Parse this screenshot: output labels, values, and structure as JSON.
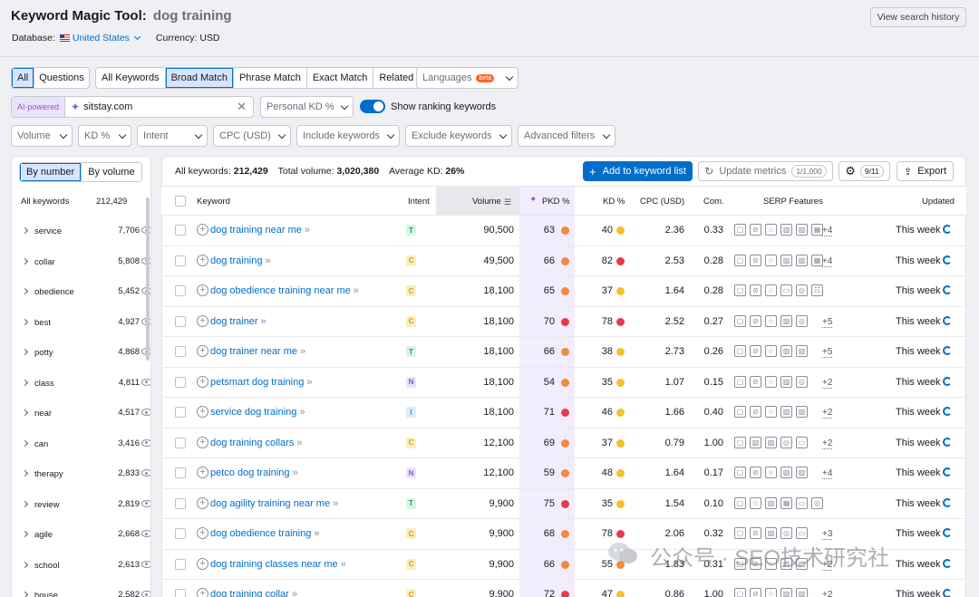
{
  "header": {
    "title": "Keyword Magic Tool:",
    "query": "dog training",
    "database_label": "Database:",
    "database_value": "United States",
    "currency_label": "Currency: USD",
    "history_button": "View search history"
  },
  "tabs_group1": [
    "All",
    "Questions"
  ],
  "tabs_group2": [
    "All Keywords",
    "Broad Match",
    "Phrase Match",
    "Exact Match",
    "Related"
  ],
  "languages": {
    "label": "Languages",
    "badge": "beta"
  },
  "ai": {
    "badge": "AI-powered",
    "domain": "sitstay.com"
  },
  "personal_kd": "Personal KD %",
  "ranking_toggle": "Show ranking keywords",
  "filters": [
    "Volume",
    "KD %",
    "Intent",
    "CPC (USD)",
    "Include keywords",
    "Exclude keywords",
    "Advanced filters"
  ],
  "side": {
    "tab_number": "By number",
    "tab_volume": "By volume",
    "all_label": "All keywords",
    "all_count": "212,429",
    "items": [
      {
        "name": "service",
        "count": "7,706"
      },
      {
        "name": "collar",
        "count": "5,808"
      },
      {
        "name": "obedience",
        "count": "5,452"
      },
      {
        "name": "best",
        "count": "4,927"
      },
      {
        "name": "potty",
        "count": "4,868"
      },
      {
        "name": "class",
        "count": "4,811"
      },
      {
        "name": "near",
        "count": "4,517"
      },
      {
        "name": "can",
        "count": "3,416"
      },
      {
        "name": "therapy",
        "count": "2,833"
      },
      {
        "name": "review",
        "count": "2,819"
      },
      {
        "name": "agile",
        "count": "2,668"
      },
      {
        "name": "school",
        "count": "2,613"
      },
      {
        "name": "house",
        "count": "2,582"
      }
    ]
  },
  "summary": {
    "all_label": "All keywords:",
    "all_value": "212,429",
    "volume_label": "Total volume:",
    "volume_value": "3,020,380",
    "kd_label": "Average KD:",
    "kd_value": "26%"
  },
  "actions": {
    "add_list": "Add to keyword list",
    "update": "Update metrics",
    "update_count": "1/1,000",
    "settings_count": "9/11",
    "export": "Export"
  },
  "columns": [
    "Keyword",
    "Intent",
    "Volume",
    "PKD %",
    "KD %",
    "CPC (USD)",
    "Com.",
    "SERP Features",
    "Updated"
  ],
  "colors": {
    "accent": "#006dca",
    "dot_orange": "#f08c3a",
    "dot_red": "#e63b4c",
    "dot_yellow": "#f5c02b",
    "intent_T": "#00a95c",
    "intent_C": "#d69e00",
    "intent_N": "#8b56d8",
    "intent_I": "#2f8fd8"
  },
  "rows": [
    {
      "kw": "dog training near me",
      "intent": "T",
      "vol": "90,500",
      "pkd": "63",
      "pc": "orange",
      "kd": "40",
      "kc": "yellow",
      "cpc": "2.36",
      "com": "0.33",
      "more": "+4",
      "upd": "This week"
    },
    {
      "kw": "dog training",
      "intent": "C",
      "vol": "49,500",
      "pkd": "66",
      "pc": "orange",
      "kd": "82",
      "kc": "red",
      "cpc": "2.53",
      "com": "0.28",
      "more": "+4",
      "upd": "This week"
    },
    {
      "kw": "dog obedience training near me",
      "intent": "C",
      "vol": "18,100",
      "pkd": "65",
      "pc": "orange",
      "kd": "37",
      "kc": "yellow",
      "cpc": "1.64",
      "com": "0.28",
      "more": "",
      "upd": "This week"
    },
    {
      "kw": "dog trainer",
      "intent": "C",
      "vol": "18,100",
      "pkd": "70",
      "pc": "red",
      "kd": "78",
      "kc": "red",
      "cpc": "2.52",
      "com": "0.27",
      "more": "+5",
      "upd": "This week"
    },
    {
      "kw": "dog trainer near me",
      "intent": "T",
      "vol": "18,100",
      "pkd": "66",
      "pc": "orange",
      "kd": "38",
      "kc": "yellow",
      "cpc": "2.73",
      "com": "0.26",
      "more": "+5",
      "upd": "This week"
    },
    {
      "kw": "petsmart dog training",
      "intent": "N",
      "vol": "18,100",
      "pkd": "54",
      "pc": "orange",
      "kd": "35",
      "kc": "yellow",
      "cpc": "1.07",
      "com": "0.15",
      "more": "+2",
      "upd": "This week"
    },
    {
      "kw": "service dog training",
      "intent": "I",
      "vol": "18,100",
      "pkd": "71",
      "pc": "red",
      "kd": "46",
      "kc": "yellow",
      "cpc": "1.66",
      "com": "0.40",
      "more": "+2",
      "upd": "This week"
    },
    {
      "kw": "dog training collars",
      "intent": "C",
      "vol": "12,100",
      "pkd": "69",
      "pc": "orange",
      "kd": "37",
      "kc": "yellow",
      "cpc": "0.79",
      "com": "1.00",
      "more": "+2",
      "upd": "This week"
    },
    {
      "kw": "petco dog training",
      "intent": "N",
      "vol": "12,100",
      "pkd": "59",
      "pc": "orange",
      "kd": "48",
      "kc": "yellow",
      "cpc": "1.64",
      "com": "0.17",
      "more": "+4",
      "upd": "This week"
    },
    {
      "kw": "dog agility training near me",
      "intent": "T",
      "vol": "9,900",
      "pkd": "75",
      "pc": "red",
      "kd": "35",
      "kc": "yellow",
      "cpc": "1.54",
      "com": "0.10",
      "more": "",
      "upd": "This week"
    },
    {
      "kw": "dog obedience training",
      "intent": "C",
      "vol": "9,900",
      "pkd": "68",
      "pc": "orange",
      "kd": "78",
      "kc": "red",
      "cpc": "2.06",
      "com": "0.32",
      "more": "+3",
      "upd": "This week"
    },
    {
      "kw": "dog training classes near me",
      "intent": "C",
      "vol": "9,900",
      "pkd": "66",
      "pc": "orange",
      "kd": "55",
      "kc": "orange",
      "cpc": "1.83",
      "com": "0.31",
      "more": "+2",
      "upd": "This week"
    },
    {
      "kw": "dog training collar",
      "intent": "C",
      "vol": "9,900",
      "pkd": "72",
      "pc": "red",
      "kd": "47",
      "kc": "yellow",
      "cpc": "0.86",
      "com": "1.00",
      "more": "+2",
      "upd": "This week"
    }
  ],
  "watermark": "公众号 · SEO技术研究社"
}
